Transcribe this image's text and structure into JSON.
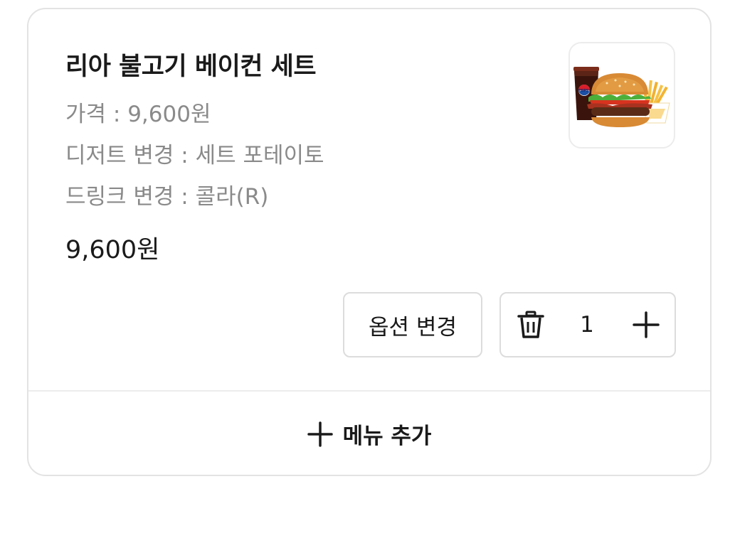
{
  "cart_item": {
    "name": "리아 불고기 베이컨 세트",
    "price_line": "가격 : 9,600원",
    "dessert_line": "디저트 변경 : 세트 포테이토",
    "drink_line": "드링크 변경 : 콜라(R)",
    "total_price": "9,600원",
    "image_icon": "burger-set-image"
  },
  "actions": {
    "change_options_label": "옵션 변경",
    "quantity": "1",
    "delete_icon": "trash-icon",
    "increment_icon": "plus-icon"
  },
  "footer": {
    "add_menu_label": "메뉴 추가",
    "add_icon": "plus-icon"
  },
  "colors": {
    "text_primary": "#1a1a1a",
    "text_secondary": "#8a8a8a",
    "border": "#dcdcdc"
  }
}
